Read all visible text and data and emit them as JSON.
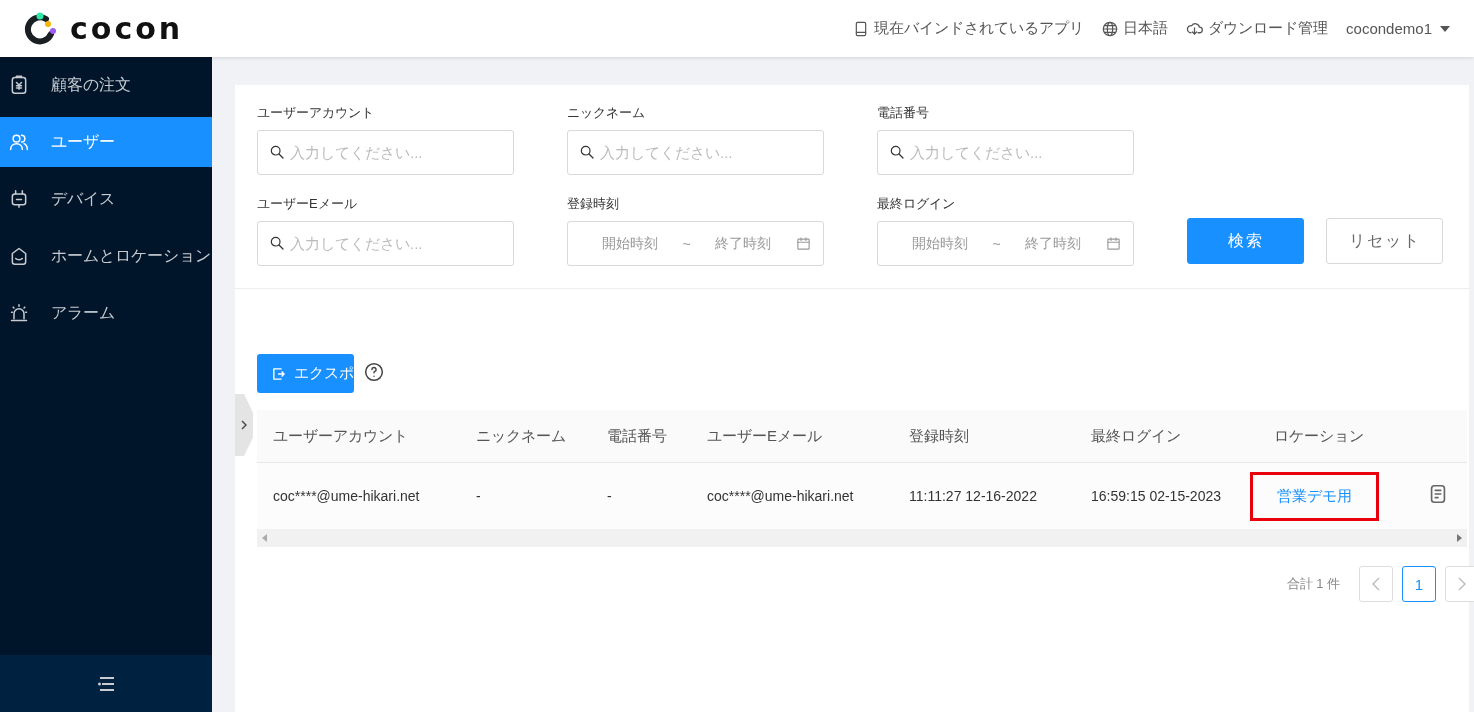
{
  "header": {
    "logo": "cocon",
    "links": [
      {
        "label": "現在バインドされているアプリ"
      },
      {
        "label": "日本語"
      },
      {
        "label": "ダウンロード管理"
      }
    ],
    "user": "cocondemo1"
  },
  "sidebar": {
    "items": [
      {
        "label": "顧客の注文",
        "selected": false
      },
      {
        "label": "ユーザー",
        "selected": true
      },
      {
        "label": "デバイス",
        "selected": false
      },
      {
        "label": "ホームとロケーション",
        "selected": false
      },
      {
        "label": "アラーム",
        "selected": false
      }
    ]
  },
  "filters": {
    "fields": [
      {
        "kind": "text",
        "label": "ユーザーアカウント",
        "placeholder": "入力してください..."
      },
      {
        "kind": "text",
        "label": "ニックネーム",
        "placeholder": "入力してください..."
      },
      {
        "kind": "text",
        "label": "電話番号",
        "placeholder": "入力してください..."
      },
      {
        "kind": "text",
        "label": "ユーザーEメール",
        "placeholder": "入力してください..."
      },
      {
        "kind": "daterange",
        "label": "登録時刻",
        "start": "開始時刻",
        "separator": "~",
        "end": "終了時刻"
      },
      {
        "kind": "daterange",
        "label": "最終ログイン",
        "start": "開始時刻",
        "separator": "~",
        "end": "終了時刻"
      }
    ],
    "buttons": [
      {
        "kind": "primary",
        "label": "検索"
      },
      {
        "kind": "default",
        "label": "リセット"
      }
    ]
  },
  "toolbar": {
    "export": "エクスポ"
  },
  "table": {
    "columns": [
      "ユーザーアカウント",
      "ニックネーム",
      "電話番号",
      "ユーザーEメール",
      "登録時刻",
      "最終ログイン",
      "ロケーション"
    ],
    "rows": [
      {
        "cells": [
          "coc****@ume-hikari.net",
          "-",
          "-",
          "coc****@ume-hikari.net",
          "11:11:27 12-16-2022",
          "16:59:15 02-15-2023",
          "営業デモ用"
        ],
        "highlighted": true
      }
    ]
  },
  "pagination": {
    "total": "合計 1 件",
    "pages": [
      {
        "label": "1",
        "selected": true
      }
    ]
  }
}
